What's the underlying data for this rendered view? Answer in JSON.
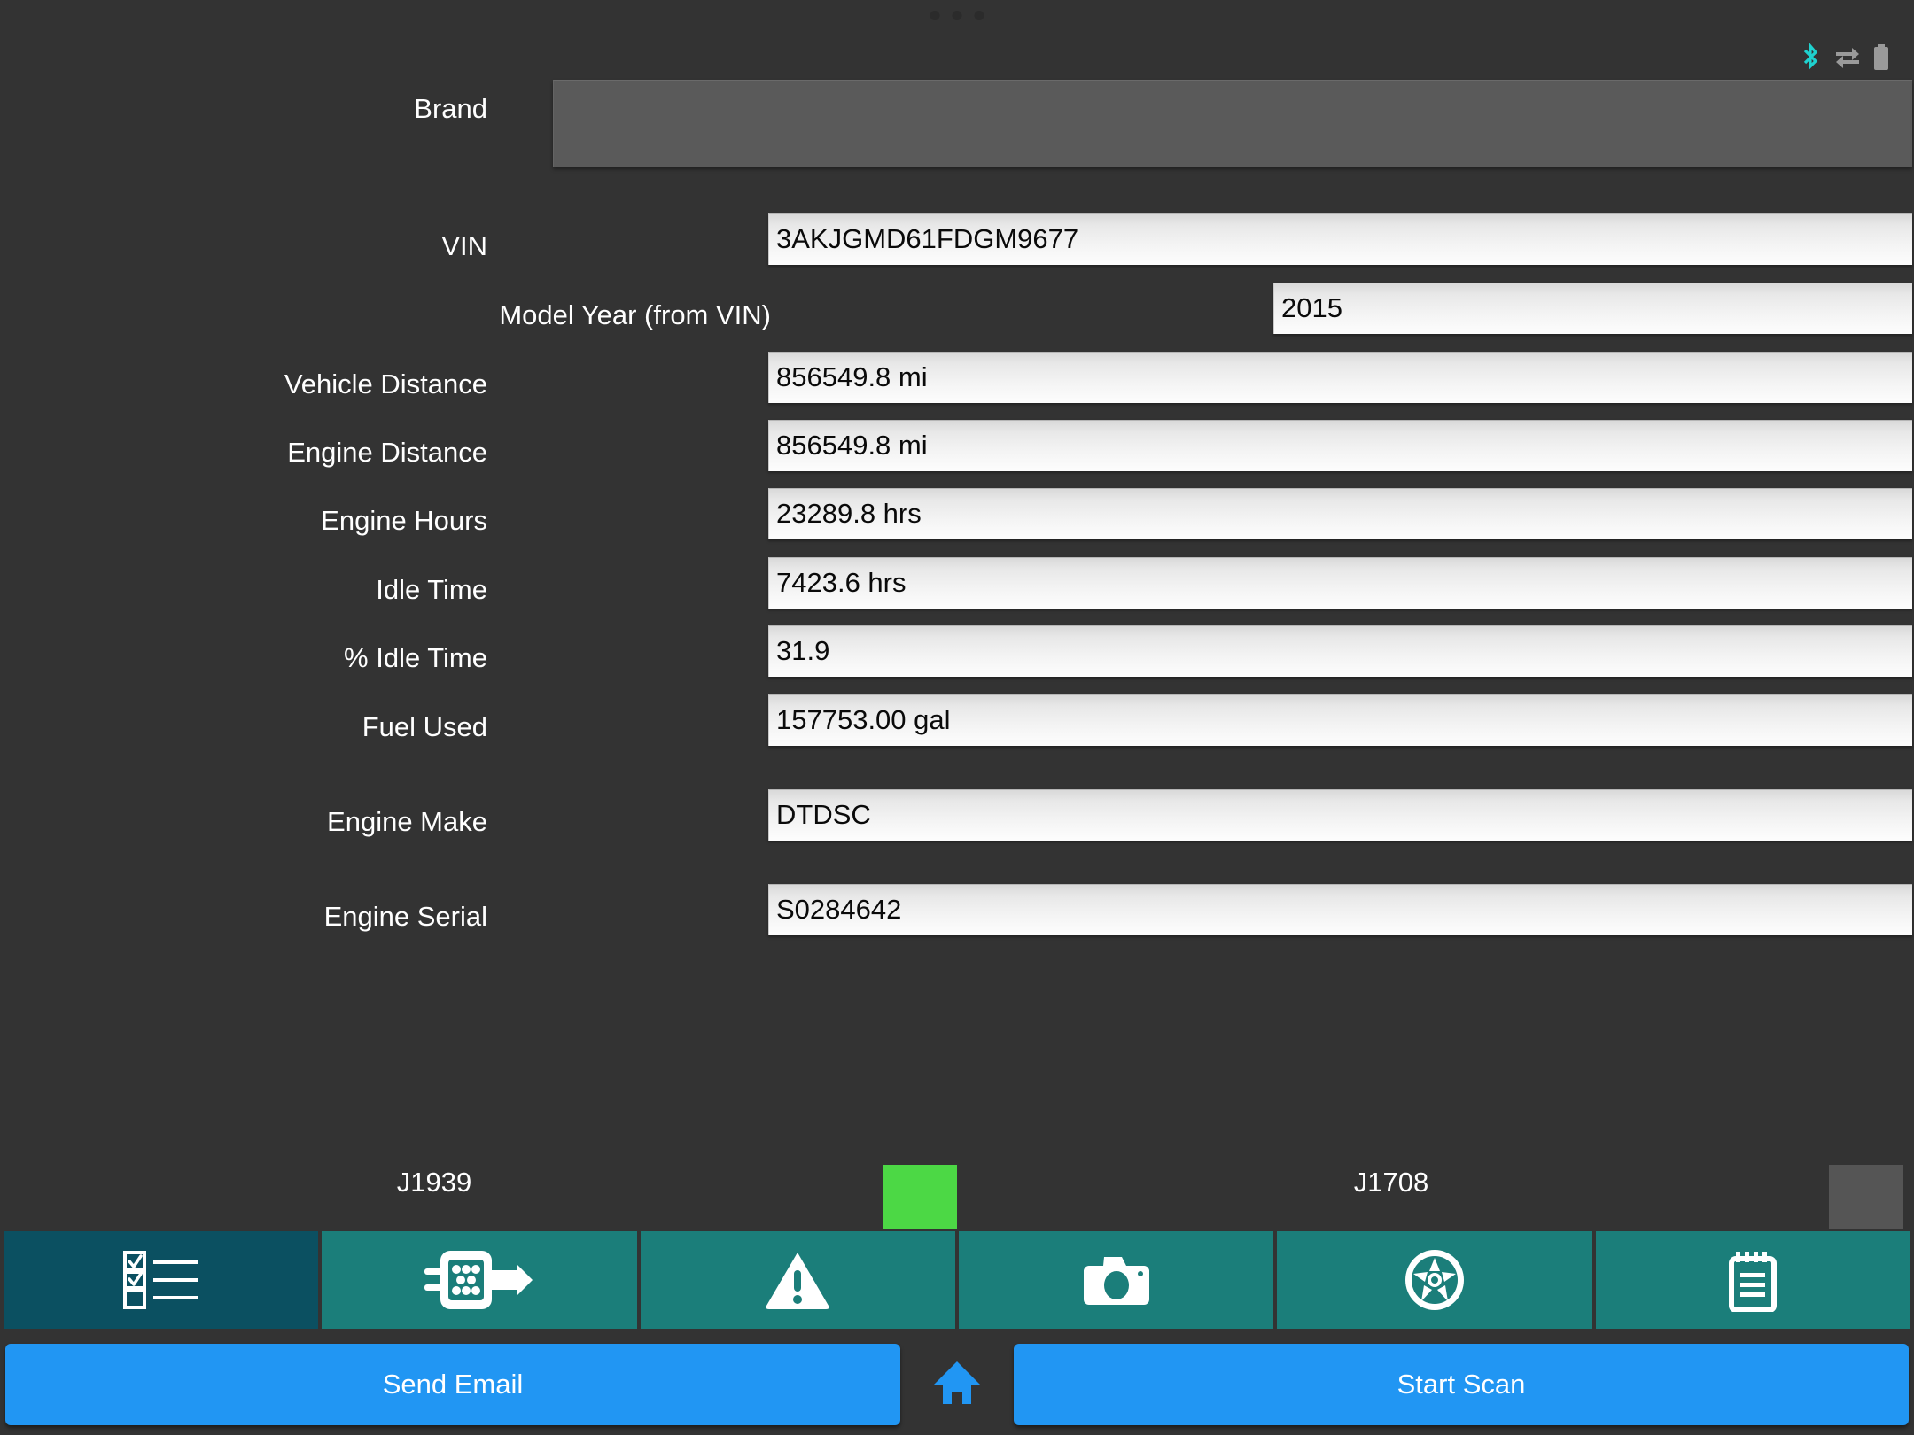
{
  "statusbar": {
    "icons": [
      {
        "name": "bluetooth-icon",
        "color": "#1fd2cf"
      },
      {
        "name": "data-transfer-icon",
        "color": "#9a9a9a"
      },
      {
        "name": "battery-icon",
        "color": "#9a9a9a"
      }
    ]
  },
  "form": {
    "rows": [
      {
        "label": "Brand",
        "value": "",
        "type": "brandbox"
      },
      {
        "label": "VIN",
        "value": "3AKJGMD61FDGM9677",
        "type": "std"
      },
      {
        "label": "Model Year (from VIN)",
        "value": "2015",
        "type": "year"
      },
      {
        "label": "Vehicle Distance",
        "value": "856549.8 mi",
        "type": "std"
      },
      {
        "label": "Engine Distance",
        "value": "856549.8 mi",
        "type": "std"
      },
      {
        "label": "Engine Hours",
        "value": "23289.8 hrs",
        "type": "std"
      },
      {
        "label": "Idle Time",
        "value": "7423.6 hrs",
        "type": "std"
      },
      {
        "label": "% Idle Time",
        "value": "31.9",
        "type": "std"
      },
      {
        "label": "Fuel Used",
        "value": "157753.00 gal",
        "type": "std"
      },
      {
        "label": "Engine Make",
        "value": "DTDSC",
        "type": "std"
      },
      {
        "label": "Engine Serial",
        "value": "S0284642",
        "type": "std"
      }
    ]
  },
  "protocols": {
    "j1939": {
      "label": "J1939",
      "status": "active",
      "color": "#4cd845"
    },
    "j1708": {
      "label": "J1708",
      "status": "inactive",
      "color": "#555555"
    }
  },
  "tabs": [
    {
      "name": "tab-checklist",
      "icon": "checklist-icon",
      "selected": true
    },
    {
      "name": "tab-connector",
      "icon": "connector-icon",
      "selected": false
    },
    {
      "name": "tab-faults",
      "icon": "warning-triangle-icon",
      "selected": false
    },
    {
      "name": "tab-camera",
      "icon": "camera-icon",
      "selected": false
    },
    {
      "name": "tab-wheel",
      "icon": "wheel-icon",
      "selected": false
    },
    {
      "name": "tab-notes",
      "icon": "notepad-icon",
      "selected": false
    }
  ],
  "actions": {
    "send_email_label": "Send Email",
    "home_icon": "home-icon",
    "start_scan_label": "Start Scan",
    "accent_color": "#2196f3"
  }
}
